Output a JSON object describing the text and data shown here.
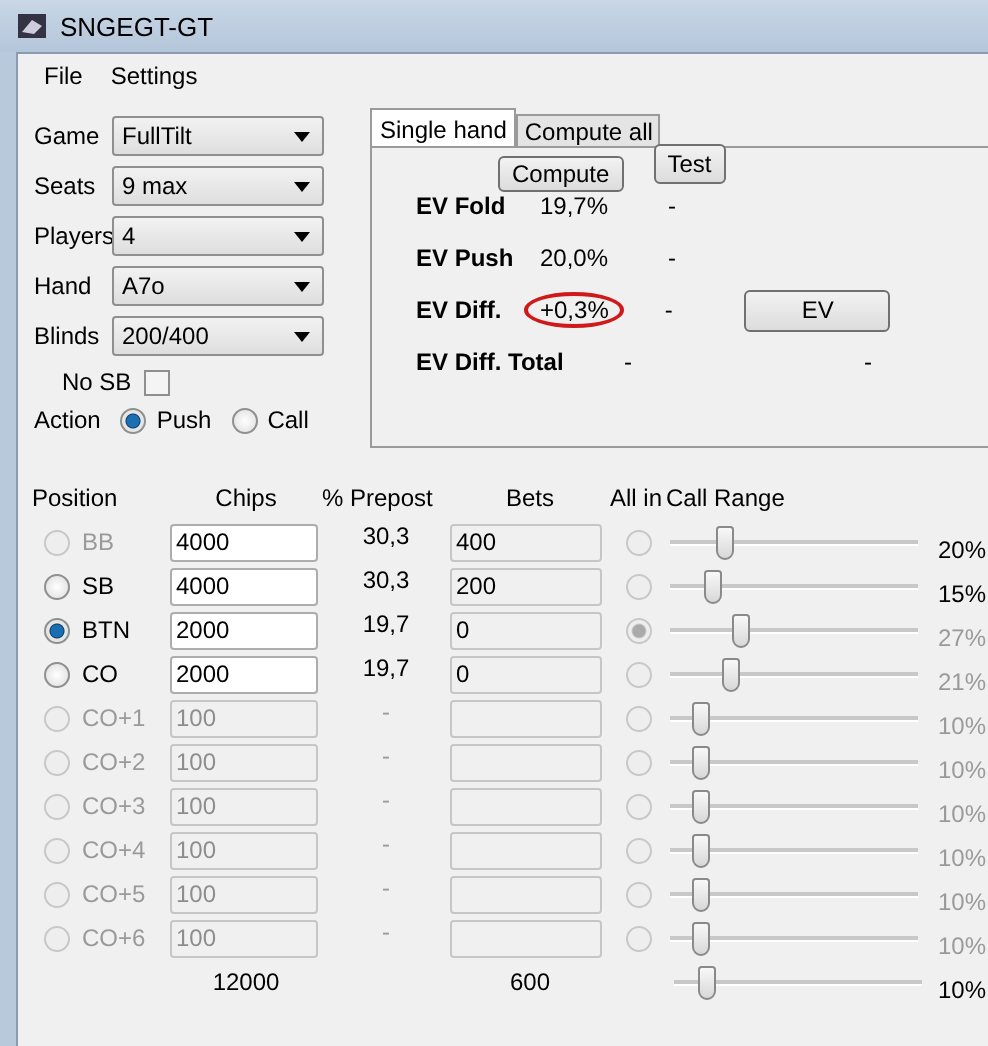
{
  "window": {
    "title": "SNGEGT-GT"
  },
  "menu": [
    "File",
    "Settings"
  ],
  "settings": [
    {
      "label": "Game",
      "value": "FullTilt"
    },
    {
      "label": "Seats",
      "value": "9 max"
    },
    {
      "label": "Players",
      "value": "4"
    },
    {
      "label": "Hand",
      "value": "A7o"
    },
    {
      "label": "Blinds",
      "value": "200/400"
    }
  ],
  "no_sb": {
    "label": "No SB",
    "checked": false
  },
  "action": {
    "label": "Action",
    "options": [
      {
        "label": "Push",
        "selected": true
      },
      {
        "label": "Call",
        "selected": false
      }
    ]
  },
  "tabs": [
    {
      "label": "Single hand",
      "selected": true
    },
    {
      "label": "Compute all",
      "selected": false
    }
  ],
  "compute_button": "Compute",
  "test_button": "Test",
  "results": [
    {
      "label": "EV Fold",
      "value": "19,7%",
      "note": "-",
      "circled": false
    },
    {
      "label": "EV Push",
      "value": "20,0%",
      "note": "-",
      "circled": false
    },
    {
      "label": "EV Diff.",
      "value": "+0,3%",
      "note": "-",
      "circled": true,
      "button": "EV"
    },
    {
      "label": "EV Diff. Total",
      "value": "-",
      "note": "-",
      "circled": false
    }
  ],
  "table": {
    "columns": [
      "Position",
      "Chips",
      "% Prepost",
      "Bets",
      "All in",
      "Call Range"
    ],
    "rows": [
      {
        "position": "BB",
        "selected": false,
        "disabled": true,
        "chips": "4000",
        "chips_disabled": false,
        "prepost": "30,3",
        "bets": "400",
        "all_in": false,
        "level": 0.22,
        "range": "20%",
        "range_disabled": false
      },
      {
        "position": "SB",
        "selected": false,
        "disabled": false,
        "chips": "4000",
        "chips_disabled": false,
        "prepost": "30,3",
        "bets": "200",
        "all_in": false,
        "level": 0.17,
        "range": "15%",
        "range_disabled": false
      },
      {
        "position": "BTN",
        "selected": true,
        "disabled": false,
        "chips": "2000",
        "chips_disabled": false,
        "prepost": "19,7",
        "bets": "0",
        "all_in": true,
        "level": 0.28,
        "range": "27%",
        "range_disabled": true
      },
      {
        "position": "CO",
        "selected": false,
        "disabled": false,
        "chips": "2000",
        "chips_disabled": false,
        "prepost": "19,7",
        "bets": "0",
        "all_in": false,
        "level": 0.24,
        "range": "21%",
        "range_disabled": true
      },
      {
        "position": "CO+1",
        "selected": false,
        "disabled": true,
        "chips": "100",
        "chips_disabled": true,
        "prepost": "-",
        "all_in": false,
        "level": 0.12,
        "range": "10%",
        "range_disabled": true
      },
      {
        "position": "CO+2",
        "selected": false,
        "disabled": true,
        "chips": "100",
        "chips_disabled": true,
        "prepost": "-",
        "all_in": false,
        "level": 0.12,
        "range": "10%",
        "range_disabled": true
      },
      {
        "position": "CO+3",
        "selected": false,
        "disabled": true,
        "chips": "100",
        "chips_disabled": true,
        "prepost": "-",
        "all_in": false,
        "level": 0.12,
        "range": "10%",
        "range_disabled": true
      },
      {
        "position": "CO+4",
        "selected": false,
        "disabled": true,
        "chips": "100",
        "chips_disabled": true,
        "prepost": "-",
        "all_in": false,
        "level": 0.12,
        "range": "10%",
        "range_disabled": true
      },
      {
        "position": "CO+5",
        "selected": false,
        "disabled": true,
        "chips": "100",
        "chips_disabled": true,
        "prepost": "-",
        "all_in": false,
        "level": 0.12,
        "range": "10%",
        "range_disabled": true
      },
      {
        "position": "CO+6",
        "selected": false,
        "disabled": true,
        "chips": "100",
        "chips_disabled": true,
        "prepost": "-",
        "all_in": false,
        "level": 0.12,
        "range": "10%",
        "range_disabled": true
      }
    ],
    "totals": {
      "chips": "12000",
      "bets": "600",
      "level": 0.13,
      "range": "10%"
    }
  }
}
